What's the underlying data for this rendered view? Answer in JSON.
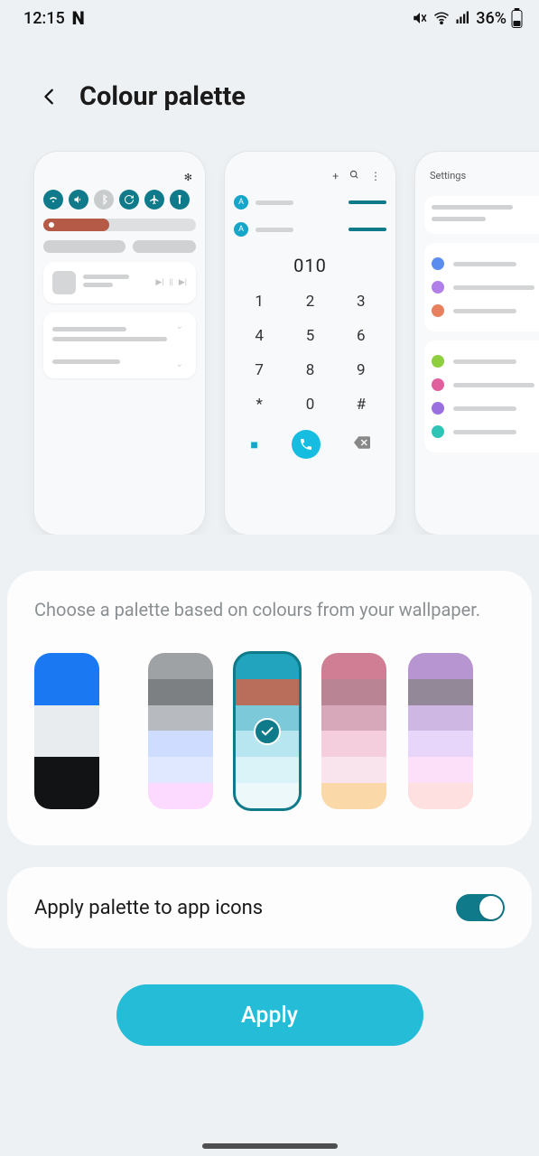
{
  "status": {
    "time": "12:15",
    "n": "N",
    "battery": "36%"
  },
  "header": {
    "title": "Colour palette"
  },
  "previews": {
    "dialer": {
      "number": "010",
      "keys": [
        "1",
        "2",
        "3",
        "4",
        "5",
        "6",
        "7",
        "8",
        "9",
        "*",
        "0",
        "#"
      ],
      "contact_initial": "A"
    },
    "settings": {
      "title": "Settings"
    }
  },
  "palette_section": {
    "description": "Choose a palette based on colours from your wallpaper.",
    "swatches": [
      {
        "colors": [
          "#1a78f2",
          "#1a78f2",
          "#e9ecef",
          "#e9ecef",
          "#111315",
          "#111315"
        ],
        "selected": false
      },
      {
        "colors": [
          "#9ea2a5",
          "#7c8083",
          "#b7bbc0",
          "#ceddff",
          "#e0e8ff",
          "#fcd9ff"
        ],
        "selected": false
      },
      {
        "colors": [
          "#22a4bf",
          "#b86e5a",
          "#7cc9da",
          "#b7e5f0",
          "#d9f3f9",
          "#edf8fb"
        ],
        "selected": true
      },
      {
        "colors": [
          "#cf7e93",
          "#b98595",
          "#d7a8b9",
          "#f4cedd",
          "#f9e4ee",
          "#fbd8a8"
        ],
        "selected": false
      },
      {
        "colors": [
          "#b795d1",
          "#928898",
          "#cfb7e4",
          "#e8d6fa",
          "#fcdff9",
          "#fde0df"
        ],
        "selected": false
      }
    ]
  },
  "toggle_card": {
    "label": "Apply palette to app icons",
    "on": true
  },
  "apply": {
    "label": "Apply"
  }
}
